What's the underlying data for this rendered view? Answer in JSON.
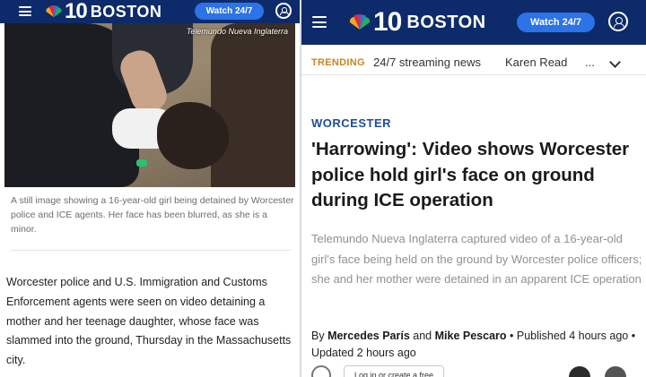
{
  "left": {
    "brand": {
      "number": "10",
      "city": "BOSTON"
    },
    "watch_label": "Watch 24/7",
    "photo_credit": "Telemundo Nueva Inglaterra",
    "caption": "A still image showing a 16-year-old girl being detained by Worcester police and ICE agents. Her face has been blurred, as she is a minor.",
    "body": "Worcester police and U.S. Immigration and Customs Enforcement agents were seen on video detaining a mother and her teenage daughter, whose face was slammed into the ground, Thursday in the Massachusetts city."
  },
  "right": {
    "brand": {
      "number": "10",
      "city": "BOSTON"
    },
    "watch_label": "Watch 24/7",
    "trending": {
      "label": "TRENDING",
      "items": [
        "24/7 streaming news",
        "Karen Read"
      ],
      "more": "..."
    },
    "kicker": "WORCESTER",
    "headline": "'Harrowing': Video shows Worcester police hold girl's face on ground during ICE operation",
    "dek": "Telemundo Nueva Inglaterra captured video of a 16-year-old girl's face being held on the ground by Worcester police officers; she and her mother were detained in an apparent ICE operation",
    "byline": {
      "prefix": "By ",
      "author1": "Mercedes París",
      "and": " and ",
      "author2": "Mike Pescaro",
      "published": " • Published 4 hours ago • Updated 2 hours ago"
    },
    "login_label": "Log in or create a free"
  },
  "colors": {
    "nav_bg": "#0d2b6b",
    "watch_btn": "#2b73e6",
    "trending": "#c8861a",
    "kicker": "#1a4f9c"
  }
}
